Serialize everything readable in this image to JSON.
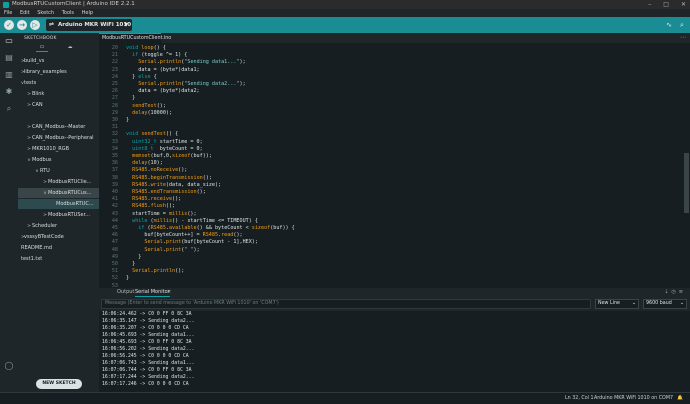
{
  "window": {
    "title": "ModbusRTUCustomClient | Arduino IDE 2.2.1"
  },
  "menu": [
    "File",
    "Edit",
    "Sketch",
    "Tools",
    "Help"
  ],
  "toolbar": {
    "board": "Arduino MKR WiFi 1010"
  },
  "sidebar": {
    "title": "SKETCHBOOK",
    "items": [
      {
        "label": "build_vs",
        "depth": 0,
        "chev": ">"
      },
      {
        "label": "library_examples",
        "depth": 0,
        "chev": ">"
      },
      {
        "label": "tests",
        "depth": 0,
        "chev": "v"
      },
      {
        "label": "Blink",
        "depth": 1,
        "chev": ">"
      },
      {
        "label": "CAN",
        "depth": 1,
        "chev": ">"
      },
      {
        "label": "CAN_Modbus--Master",
        "depth": 1,
        "chev": ">"
      },
      {
        "label": "CAN_Modbus--Peripheral",
        "depth": 1,
        "chev": ">"
      },
      {
        "label": "MKR1010_RGB",
        "depth": 1,
        "chev": ">"
      },
      {
        "label": "Modbus",
        "depth": 1,
        "chev": "v"
      },
      {
        "label": "RTU",
        "depth": 2,
        "chev": "v"
      },
      {
        "label": "ModbusRTUClie...",
        "depth": 3,
        "chev": ">"
      },
      {
        "label": "ModbusRTUCus...",
        "depth": 3,
        "chev": "v"
      },
      {
        "label": "ModbusRTUC...",
        "depth": 4,
        "chev": ""
      },
      {
        "label": "ModbusRTUSer...",
        "depth": 3,
        "chev": ">"
      },
      {
        "label": "Scheduler",
        "depth": 1,
        "chev": ">"
      },
      {
        "label": "vsssyBTestCode",
        "depth": 0,
        "chev": ">"
      },
      {
        "label": "README.md",
        "depth": 0,
        "chev": ""
      },
      {
        "label": "test1.txt",
        "depth": 0,
        "chev": ""
      }
    ],
    "new_sketch": "NEW SKETCH"
  },
  "editor": {
    "tab": "ModbusRTUCustomClient.ino",
    "lines": [
      {
        "n": "20",
        "t": "void loop() {"
      },
      {
        "n": "21",
        "t": "  if (toggle ^= 1) {"
      },
      {
        "n": "22",
        "t": "    Serial.println(\"Sending data1...\");"
      },
      {
        "n": "23",
        "t": "    data = (byte*)data1;"
      },
      {
        "n": "24",
        "t": "  } else {"
      },
      {
        "n": "25",
        "t": "    Serial.println(\"Sending data2...\");"
      },
      {
        "n": "26",
        "t": "    data = (byte*)data2;"
      },
      {
        "n": "27",
        "t": "  }"
      },
      {
        "n": "28",
        "t": "  sendTest();"
      },
      {
        "n": "29",
        "t": "  delay(10000);"
      },
      {
        "n": "30",
        "t": "}"
      },
      {
        "n": "31",
        "t": ""
      },
      {
        "n": "32",
        "t": "void sendTest() {"
      },
      {
        "n": "33",
        "t": "  uint32_t startTime = 0;"
      },
      {
        "n": "34",
        "t": "  uint8_t  byteCount = 0;"
      },
      {
        "n": "35",
        "t": "  memset(buf,0,sizeof(buf));"
      },
      {
        "n": "36",
        "t": "  delay(10);"
      },
      {
        "n": "37",
        "t": "  RS485.noReceive();"
      },
      {
        "n": "38",
        "t": "  RS485.beginTransmission();"
      },
      {
        "n": "39",
        "t": "  RS485.write(data, data_size);"
      },
      {
        "n": "40",
        "t": "  RS485.endTransmission();"
      },
      {
        "n": "41",
        "t": "  RS485.receive();"
      },
      {
        "n": "42",
        "t": "  RS485.flush();"
      },
      {
        "n": "43",
        "t": "  startTime = millis();"
      },
      {
        "n": "44",
        "t": "  while (millis() - startTime <= TIMEOUT) {"
      },
      {
        "n": "45",
        "t": "    if (RS485.available() && byteCount < sizeof(buf)) {"
      },
      {
        "n": "46",
        "t": "      buf[byteCount++] = RS485.read();"
      },
      {
        "n": "47",
        "t": "      Serial.print(buf[byteCount - 1],HEX);"
      },
      {
        "n": "48",
        "t": "      Serial.print(\" \");"
      },
      {
        "n": "49",
        "t": "    }"
      },
      {
        "n": "50",
        "t": "  }"
      },
      {
        "n": "51",
        "t": "  Serial.println();"
      },
      {
        "n": "52",
        "t": "}"
      },
      {
        "n": "53",
        "t": ""
      }
    ]
  },
  "panel": {
    "tab_output": "Output",
    "tab_serial": "Serial Monitor",
    "message_placeholder": "Message (Enter to send message to 'Arduino MKR WiFi 1010' on 'COM7')",
    "line_ending": "New Line",
    "baud": "9600 baud",
    "lines": [
      "16:06:24.462 -> C0 0 FF 0 8C 3A",
      "16:06:35.147 -> Sending data2...",
      "16:06:35.207 -> C0 0 0 0 CD CA",
      "16:06:45.693 -> Sending data1...",
      "16:06:45.693 -> C0 0 FF 0 8C 3A",
      "16:06:56.202 -> Sending data2...",
      "16:06:56.245 -> C0 0 0 0 CD CA",
      "16:07:06.743 -> Sending data1...",
      "16:07:06.744 -> C0 0 FF 0 8C 3A",
      "16:07:17.244 -> Sending data2...",
      "16:07:17.246 -> C0 0 0 0 CD CA"
    ]
  },
  "status": {
    "position": "Ln 32, Col 1",
    "board": "Arduino MKR WiFi 1010 on COM7"
  }
}
